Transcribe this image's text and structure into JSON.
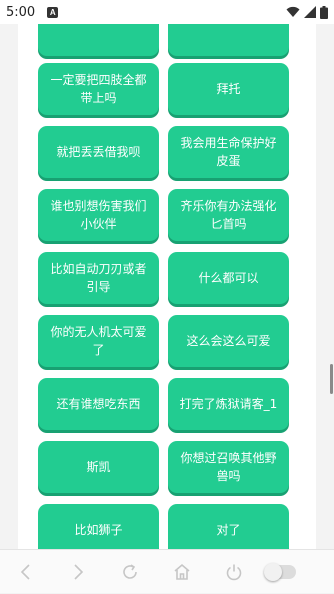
{
  "status_bar": {
    "time": "5:00",
    "notification_icon": "A"
  },
  "buttons": [
    {
      "label": ""
    },
    {
      "label": ""
    },
    {
      "label": "一定要把四肢全都带上吗"
    },
    {
      "label": "拜托"
    },
    {
      "label": "就把丢丢借我呗"
    },
    {
      "label": "我会用生命保护好皮蛋"
    },
    {
      "label": "谁也别想伤害我们小伙伴"
    },
    {
      "label": "齐乐你有办法强化匕首吗"
    },
    {
      "label": "比如自动刀刃或者引导"
    },
    {
      "label": "什么都可以"
    },
    {
      "label": "你的无人机太可爱了"
    },
    {
      "label": "这么会这么可爱"
    },
    {
      "label": "还有谁想吃东西"
    },
    {
      "label": "打完了炼狱请客_1"
    },
    {
      "label": "斯凯"
    },
    {
      "label": "你想过召唤其他野兽吗"
    },
    {
      "label": "比如狮子"
    },
    {
      "label": "对了"
    },
    {
      "label": ""
    },
    {
      "label": ""
    }
  ],
  "colors": {
    "button": "#22cc91",
    "button_shadow": "#18a172"
  },
  "nav_icons": [
    "back-icon",
    "forward-icon",
    "refresh-icon",
    "home-icon",
    "power-icon",
    "toggle-switch"
  ]
}
